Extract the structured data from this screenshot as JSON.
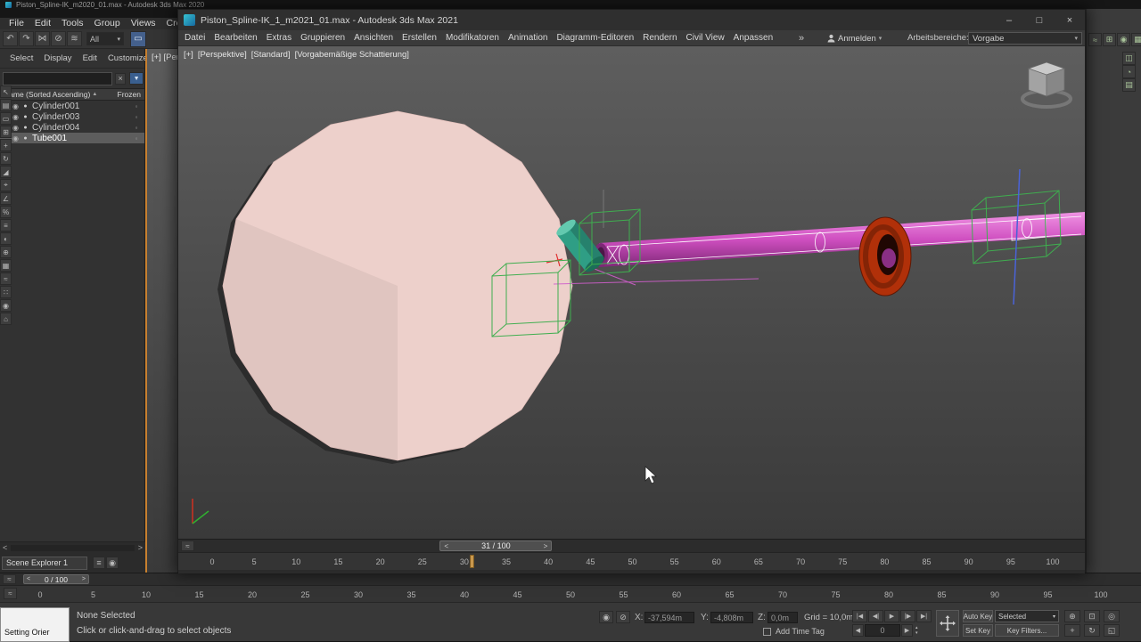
{
  "frame_ticks": [
    "0",
    "5",
    "10",
    "15",
    "20",
    "25",
    "30",
    "35",
    "40",
    "45",
    "50",
    "55",
    "60",
    "65",
    "70",
    "75",
    "80",
    "85",
    "90",
    "95",
    "100"
  ],
  "bg": {
    "title": "Piston_Spline-IK_m2020_01.max - Autodesk 3ds Max 2020",
    "menus": [
      "File",
      "Edit",
      "Tools",
      "Group",
      "Views",
      "Cre"
    ],
    "toolbar_icons": [
      {
        "name": "undo-icon",
        "glyph": "↶"
      },
      {
        "name": "redo-icon",
        "glyph": "↷"
      },
      {
        "name": "select-and-link-icon",
        "glyph": "⋈"
      },
      {
        "name": "unlink-selection-icon",
        "glyph": "⊘"
      },
      {
        "name": "bind-to-space-warp-icon",
        "glyph": "≋"
      }
    ],
    "all_dropdown": "All",
    "dd_arrow": "▾",
    "active_region_glyph": "▭",
    "left_toolbar_icons": [
      {
        "name": "select-object-icon",
        "glyph": "↖"
      },
      {
        "name": "select-by-name-icon",
        "glyph": "▤"
      },
      {
        "name": "selection-region-icon",
        "glyph": "▭"
      },
      {
        "name": "window-crossing-icon",
        "glyph": "⊞"
      },
      {
        "name": "select-and-move-icon",
        "glyph": "+"
      },
      {
        "name": "select-and-rotate-icon",
        "glyph": "↻"
      },
      {
        "name": "select-and-scale-icon",
        "glyph": "◢"
      },
      {
        "name": "pivot-icon",
        "glyph": "⌖"
      },
      {
        "name": "snap-toggle-icon",
        "glyph": "∠"
      },
      {
        "name": "percent-snap-icon",
        "glyph": "%"
      },
      {
        "name": "named-sets-icon",
        "glyph": "≡"
      },
      {
        "name": "mirror-icon",
        "glyph": "◐"
      },
      {
        "name": "align-icon",
        "glyph": "⊕"
      },
      {
        "name": "layer-manager-icon",
        "glyph": "▦"
      },
      {
        "name": "curve-editor-icon",
        "glyph": "≈"
      },
      {
        "name": "schematic-view-icon",
        "glyph": "∷"
      },
      {
        "name": "material-editor-icon",
        "glyph": "◉"
      },
      {
        "name": "render-setup-icon",
        "glyph": "⌂"
      }
    ],
    "right_toolbar_icons": [
      {
        "name": "curve-editor-icon",
        "glyph": "≈"
      },
      {
        "name": "schematic-view-icon",
        "glyph": "⊞"
      },
      {
        "name": "material-editor-icon",
        "glyph": "◉"
      },
      {
        "name": "render-setup-icon",
        "glyph": "▦"
      }
    ],
    "right_panel_icons": [
      {
        "name": "rendered-frame-icon",
        "glyph": "◫"
      },
      {
        "name": "render-production-icon",
        "glyph": "◔"
      },
      {
        "name": "command-panel-icon",
        "glyph": "▤"
      }
    ],
    "explorer": {
      "tabs": [
        "Select",
        "Display",
        "Edit",
        "Customize"
      ],
      "clear": "×",
      "filter_glyph": "▼",
      "header": {
        "name": "Name (Sorted Ascending)",
        "sort": "▲",
        "frozen": "Frozen"
      },
      "rows": [
        {
          "label": "Cylinder001",
          "expand": "▸",
          "eye": "◉",
          "dot": "●",
          "frozen": "◦",
          "selected": false
        },
        {
          "label": "Cylinder003",
          "expand": "",
          "eye": "◉",
          "dot": "●",
          "frozen": "◦",
          "selected": false
        },
        {
          "label": "Cylinder004",
          "expand": "",
          "eye": "◉",
          "dot": "●",
          "frozen": "◦",
          "selected": false
        },
        {
          "label": "Tube001",
          "expand": "",
          "eye": "◉",
          "dot": "●",
          "frozen": "◦",
          "selected": true
        }
      ],
      "scroll_left": "<",
      "scroll_right": ">",
      "footer_tab": "Scene Explorer 1",
      "footer_icons": [
        {
          "name": "explorer-menu-icon",
          "glyph": "≡"
        },
        {
          "name": "explorer-settings-icon",
          "glyph": "◉"
        }
      ]
    },
    "viewport_label_clipped": "[+] [Persp",
    "timeline": {
      "slider": "0 / 100",
      "prev": "<",
      "next": ">",
      "curve_icon": "≈"
    },
    "status": {
      "listener": "Setting Orier",
      "line1": "None Selected",
      "line2": "Click or click-and-drag to select objects",
      "isolate_glyph": "◉",
      "lock_glyph": "⊘",
      "x_label": "X:",
      "x_value": "-37,594m",
      "y_label": "Y:",
      "y_value": "-4,808m",
      "z_label": "Z:",
      "z_value": "0,0m",
      "grid": "Grid = 10,0m",
      "add_time_tag": "Add Time Tag",
      "playback": [
        {
          "name": "go-to-start-button",
          "glyph": "|◀"
        },
        {
          "name": "previous-frame-button",
          "glyph": "◀|"
        },
        {
          "name": "play-button",
          "glyph": "▶"
        },
        {
          "name": "next-frame-button",
          "glyph": "|▶"
        },
        {
          "name": "go-to-end-button",
          "glyph": "▶|"
        }
      ],
      "frame_prev": "◀",
      "frame_value": "0",
      "frame_next": "▶",
      "spinner_up": "▴",
      "spinner_down": "▾",
      "auto_key": "Auto Key",
      "set_key": "Set Key",
      "selected_dd": "Selected",
      "dd_arrow": "▾",
      "key_filters": "Key Filters...",
      "nav_row1": [
        {
          "name": "zoom-icon",
          "glyph": "⊕"
        },
        {
          "name": "zoom-extents-icon",
          "glyph": "⊡"
        },
        {
          "name": "field-of-view-icon",
          "glyph": "◎"
        }
      ],
      "nav_row2": [
        {
          "name": "pan-icon",
          "glyph": "+"
        },
        {
          "name": "orbit-icon",
          "glyph": "↻"
        },
        {
          "name": "maximize-viewport-icon",
          "glyph": "◱"
        }
      ]
    }
  },
  "fg": {
    "title": "Piston_Spline-IK_1_m2021_01.max - Autodesk 3ds Max 2021",
    "window_buttons": {
      "minimize": "–",
      "maximize": "□",
      "close": "×"
    },
    "menus": [
      "Datei",
      "Bearbeiten",
      "Extras",
      "Gruppieren",
      "Ansichten",
      "Erstellen",
      "Modifikatoren",
      "Animation",
      "Diagramm-Editoren",
      "Rendern",
      "Civil View",
      "Anpassen"
    ],
    "overflow": "»",
    "signin": "Anmelden",
    "workspace_label": "Arbeitsbereiche:",
    "workspace_value": "Vorgabe",
    "dd_arrow": "▾",
    "viewport_labels": [
      "[+]",
      "[Perspektive]",
      "[Standard]",
      "[Vorgabemäßige Schattierung]"
    ],
    "timeline": {
      "slider": "31 / 100",
      "prev": "<",
      "next": ">",
      "curve_icon": "≈",
      "current_frame": 31
    },
    "colors": {
      "disc": "#edd0cb",
      "rod": "#cf4fc0",
      "torus": "#b13009",
      "helpers": "#3fae4f",
      "piston": "#2f9e85",
      "ik_line": "#4a63d8",
      "selection": "#ffffff",
      "marker": "#c9984d"
    }
  }
}
